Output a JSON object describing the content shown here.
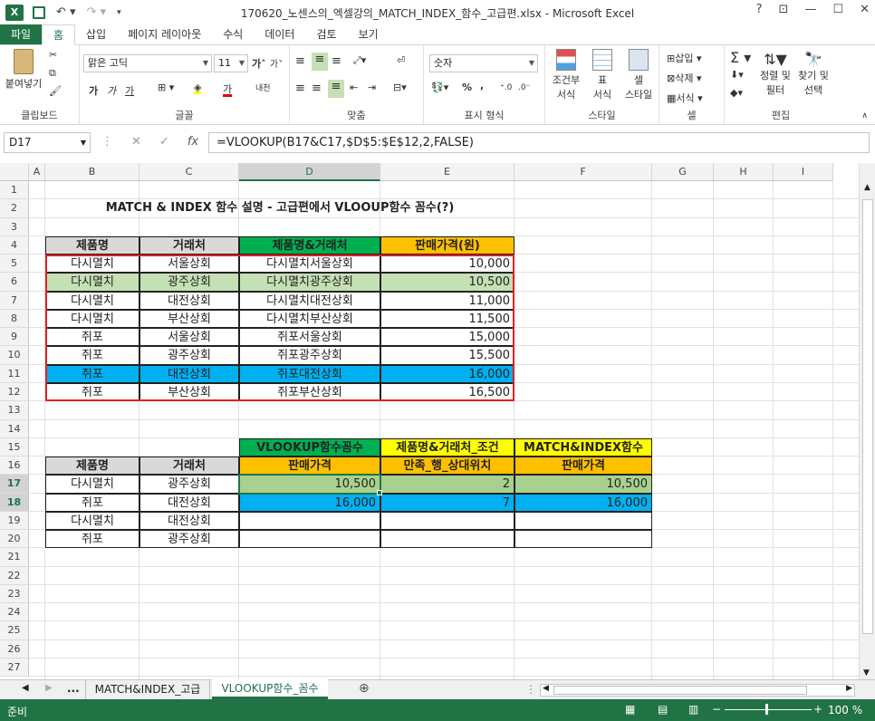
{
  "window": {
    "title": "170620_노센스의_엑셀강의_MATCH_INDEX_함수_고급편.xlsx - Microsoft Excel",
    "help": "?",
    "minimize": "—",
    "restore": "☐",
    "close": "✕"
  },
  "tabs": [
    "파일",
    "홈",
    "삽입",
    "페이지 레이아웃",
    "수식",
    "데이터",
    "검토",
    "보기"
  ],
  "ribbon": {
    "clipboard": {
      "paste": "붙여넣기",
      "label": "클립보드"
    },
    "font": {
      "name": "맑은 고딕",
      "size": "11",
      "bold": "가",
      "italic": "가",
      "underline": "가",
      "grow": "가",
      "shrink": "가",
      "phonetic": "내천",
      "label": "글꼴"
    },
    "align": {
      "label": "맞춤"
    },
    "number": {
      "format": "숫자",
      "percent": "%",
      "comma": ",",
      "label": "표시 형식"
    },
    "style": {
      "cond": "조건부\n서식",
      "table": "표\n서식",
      "cellstyle": "셀\n스타일",
      "label": "스타일"
    },
    "cells": {
      "insert": "삽입",
      "delete": "삭제",
      "format": "서식",
      "label": "셀"
    },
    "edit": {
      "sort": "정렬 및\n필터",
      "find": "찾기 및\n선택",
      "label": "편집"
    }
  },
  "formula_bar": {
    "name_box": "D17",
    "formula": "=VLOOKUP(B17&C17,$D$5:$E$12,2,FALSE)"
  },
  "columns": [
    "A",
    "B",
    "C",
    "D",
    "E",
    "F",
    "G",
    "H",
    "I"
  ],
  "rows": [
    "1",
    "2",
    "3",
    "4",
    "5",
    "6",
    "7",
    "8",
    "9",
    "10",
    "11",
    "12",
    "13",
    "14",
    "15",
    "16",
    "17",
    "18",
    "19",
    "20",
    "21",
    "22",
    "23",
    "24",
    "25",
    "26",
    "27"
  ],
  "sheet": {
    "title": "MATCH & INDEX 함수 설명 - 고급편에서 VLOOUP함수 꼼수(?)",
    "table1": {
      "headers": [
        "제품명",
        "거래처",
        "제품명&거래처",
        "판매가격(원)"
      ],
      "rows": [
        [
          "다시멸치",
          "서울상회",
          "다시멸치서울상회",
          "10,000"
        ],
        [
          "다시멸치",
          "광주상회",
          "다시멸치광주상회",
          "10,500"
        ],
        [
          "다시멸치",
          "대전상회",
          "다시멸치대전상회",
          "11,000"
        ],
        [
          "다시멸치",
          "부산상회",
          "다시멸치부산상회",
          "11,500"
        ],
        [
          "쥐포",
          "서울상회",
          "쥐포서울상회",
          "15,000"
        ],
        [
          "쥐포",
          "광주상회",
          "쥐포광주상회",
          "15,500"
        ],
        [
          "쥐포",
          "대전상회",
          "쥐포대전상회",
          "16,000"
        ],
        [
          "쥐포",
          "부산상회",
          "쥐포부산상회",
          "16,500"
        ]
      ]
    },
    "table2": {
      "top_headers": [
        "VLOOKUP함수꼼수",
        "제품명&거래처_조건",
        "MATCH&INDEX함수"
      ],
      "headers": [
        "제품명",
        "거래처",
        "판매가격",
        "만족_행_상대위치",
        "판매가격"
      ],
      "rows": [
        [
          "다시멸치",
          "광주상회",
          "10,500",
          "2",
          "10,500"
        ],
        [
          "쥐포",
          "대전상회",
          "16,000",
          "7",
          "16,000"
        ],
        [
          "다시멸치",
          "대전상회",
          "",
          "",
          ""
        ],
        [
          "쥐포",
          "광주상회",
          "",
          "",
          ""
        ]
      ]
    }
  },
  "sheet_tabs": [
    "...",
    "MATCH&INDEX_고급",
    "VLOOKUP함수_꼼수"
  ],
  "status": {
    "ready": "준비",
    "zoom": "100 %"
  },
  "colors": {
    "excel_green": "#217346",
    "green_band": "#00b050",
    "orange_band": "#ffc000",
    "yellow_band": "#ffff00",
    "light_green_fill": "#c5e0b4",
    "blue_fill": "#00b0f0",
    "red_border": "#e02020"
  }
}
